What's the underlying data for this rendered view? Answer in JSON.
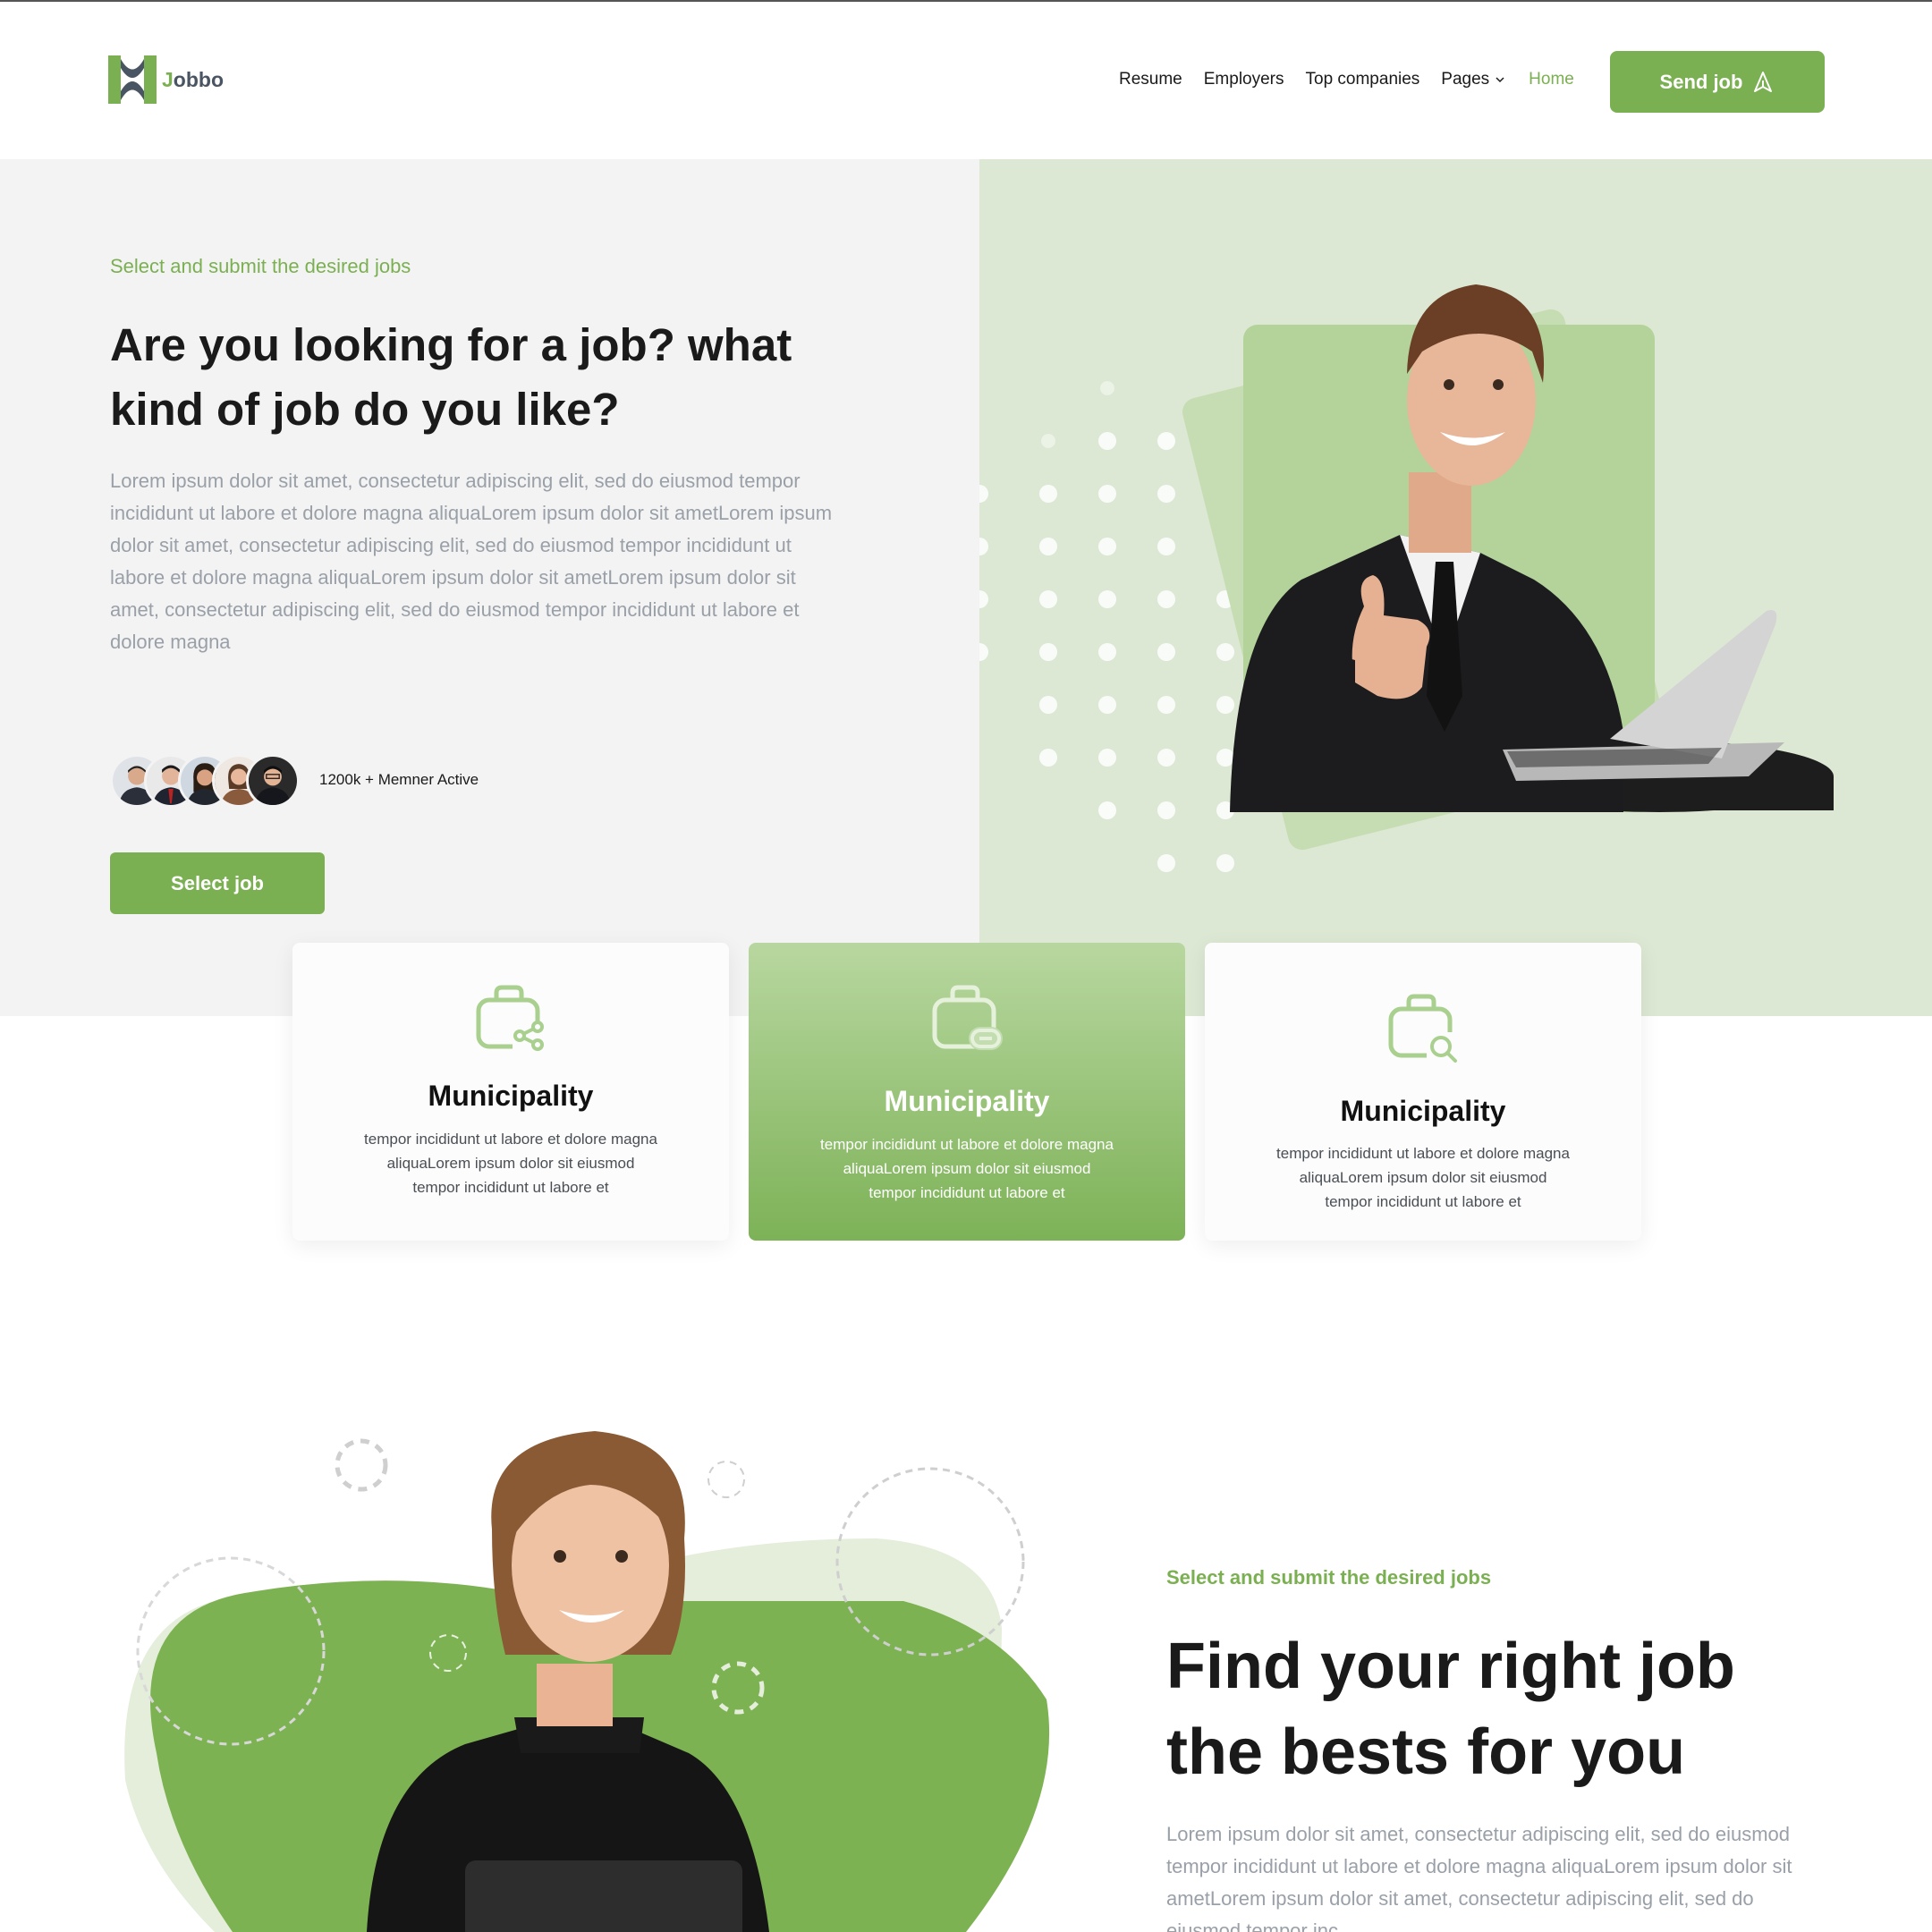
{
  "brand": {
    "name_prefix": "J",
    "name_rest": "obbo",
    "accent_color": "#7bb052"
  },
  "nav": {
    "items": [
      {
        "label": "Resume"
      },
      {
        "label": "Employers"
      },
      {
        "label": "Top companies"
      },
      {
        "label": "Pages"
      },
      {
        "label": "Home"
      }
    ],
    "active": "Home",
    "cta_label": "Send job"
  },
  "hero": {
    "eyebrow": "Select and submit the desired jobs",
    "title": "Are you looking for a job? what kind of job do you like?",
    "body": "Lorem ipsum dolor sit amet, consectetur adipiscing elit, sed do eiusmod tempor incididunt ut labore et dolore magna aliquaLorem ipsum dolor sit ametLorem ipsum dolor sit amet, consectetur adipiscing elit, sed do eiusmod tempor incididunt ut labore et dolore magna aliquaLorem ipsum dolor sit ametLorem ipsum dolor sit amet, consectetur adipiscing elit, sed do eiusmod tempor incididunt ut labore et dolore magna",
    "members_text": "1200k + Memner Active",
    "cta_label": "Select job"
  },
  "cards": [
    {
      "icon": "briefcase-share-icon",
      "title": "Municipality",
      "text": "tempor incididunt ut labore et dolore magna aliquaLorem ipsum dolor sit eiusmod tempor incididunt ut labore et"
    },
    {
      "icon": "briefcase-link-icon",
      "title": "Municipality",
      "text": "tempor incididunt ut labore et dolore magna aliquaLorem ipsum dolor sit eiusmod tempor incididunt ut labore et"
    },
    {
      "icon": "briefcase-search-icon",
      "title": "Municipality",
      "text": "tempor incididunt ut labore et dolore magna aliquaLorem ipsum dolor sit eiusmod tempor incididunt ut labore et"
    }
  ],
  "section2": {
    "eyebrow": "Select and submit the desired jobs",
    "title": "Find your right job the bests for you",
    "body": "Lorem ipsum dolor sit amet, consectetur adipiscing elit, sed do eiusmod tempor incididunt ut labore et dolore magna aliquaLorem ipsum dolor sit ametLorem ipsum dolor sit amet, consectetur adipiscing elit, sed do eiusmod tempor inc"
  }
}
